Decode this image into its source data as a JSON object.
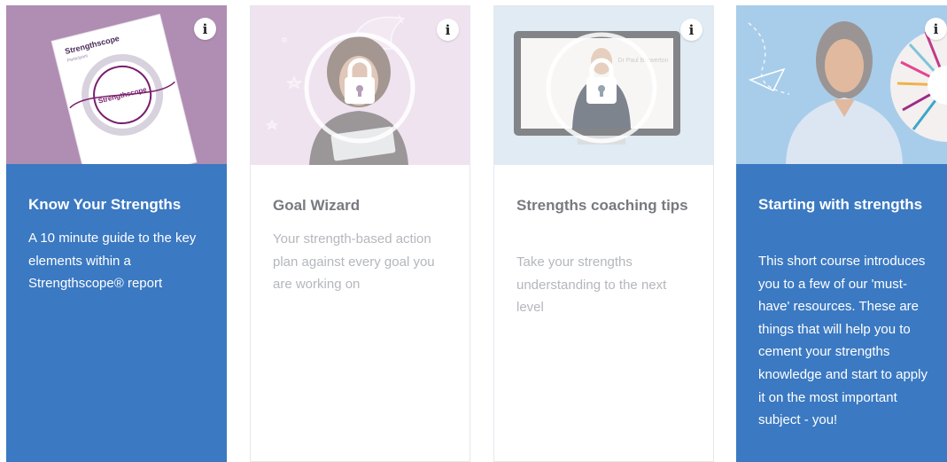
{
  "cards": [
    {
      "title": "Know Your Strengths",
      "description": "A 10 minute guide to the key elements within a Strengthscope® report",
      "locked": false,
      "thumb_bg": "#b08db2",
      "report_brand": "Strengthscope",
      "report_subtitle": "Participant",
      "report_logo": "Strengthscope",
      "info_icon": "i"
    },
    {
      "title": "Goal Wizard",
      "description": "Your strength-based action plan against every goal you are working on",
      "locked": true,
      "thumb_bg": "#e2cde3",
      "info_icon": "i"
    },
    {
      "title": "Strengths coaching tips",
      "description": "Take your strengths understanding to the next level",
      "locked": true,
      "thumb_bg": "#cfe0ef",
      "screen_caption": "Dr Paul Brewerton",
      "info_icon": "i"
    },
    {
      "title": "Starting with strengths",
      "description": "This short course introduces you to a few of our 'must-have' resources. These are things that will help you to cement your strengths knowledge and start to apply it on the most important subject - you!",
      "locked": false,
      "thumb_bg": "#a8cdea",
      "info_icon": "i"
    }
  ],
  "colors": {
    "accent_blue": "#3b79c2",
    "locked_title": "#777a80",
    "locked_text": "#b4b7bc"
  }
}
